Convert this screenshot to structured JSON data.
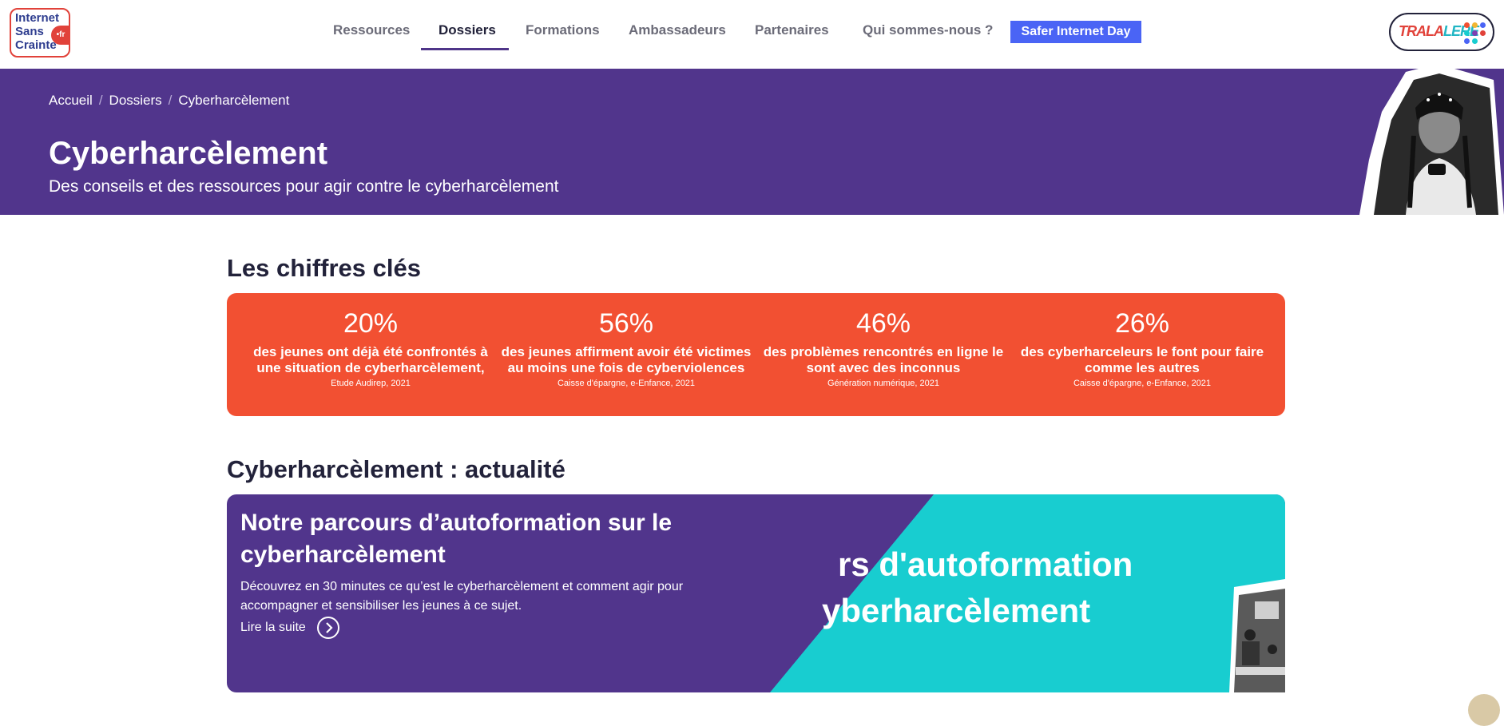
{
  "header": {
    "logo": {
      "line1": "Internet",
      "line2": "Sans",
      "line3": "Crainte",
      "suffix": "•fr"
    },
    "nav": [
      {
        "label": "Ressources"
      },
      {
        "label": "Dossiers"
      },
      {
        "label": "Formations"
      },
      {
        "label": "Ambassadeurs"
      },
      {
        "label": "Partenaires"
      },
      {
        "label": "Qui sommes-nous ?"
      }
    ],
    "active_nav": "Dossiers",
    "cta_label": "Safer Internet Day",
    "partner_logo": {
      "part1": "TRALA",
      "part2": "LERE"
    }
  },
  "banner": {
    "breadcrumb": [
      "Accueil",
      "Dossiers",
      "Cyberharcèlement"
    ],
    "title": "Cyberharcèlement",
    "subtitle": "Des conseils et des ressources pour agir contre le cyberharcèlement"
  },
  "stats_section": {
    "title": "Les chiffres clés",
    "stats": [
      {
        "value": "20%",
        "label": "des jeunes ont déjà été confrontés à une situation de cyberharcèlement,",
        "source": "Etude Audirep, 2021"
      },
      {
        "value": "56%",
        "label": "des jeunes affirment avoir été victimes au moins une fois de cyberviolences",
        "source": "Caisse d'épargne, e-Enfance, 2021"
      },
      {
        "value": "46%",
        "label": "des problèmes rencontrés en ligne le sont avec des inconnus",
        "source": "Génération numérique, 2021"
      },
      {
        "value": "26%",
        "label": "des cyberharceleurs le font pour faire comme les autres",
        "source": "Caisse d'épargne, e-Enfance, 2021"
      }
    ]
  },
  "news_section": {
    "title": "Cyberharcèlement : actualité",
    "card": {
      "title": "Notre parcours d’autoformation sur le cyberharcèlement",
      "text": "Découvrez en 30 minutes ce qu’est le cyberharcèlement et comment agir pour accompagner et sensibiliser les jeunes à ce sujet.",
      "link_label": "Lire la suite",
      "image_text_line1": "rs d'autoformation",
      "image_text_line2": "yberharcèlement"
    }
  },
  "colors": {
    "brand_purple": "#51358c",
    "stats_orange": "#f25032",
    "cta_blue": "#4a64f5",
    "teal": "#18cdd0"
  }
}
